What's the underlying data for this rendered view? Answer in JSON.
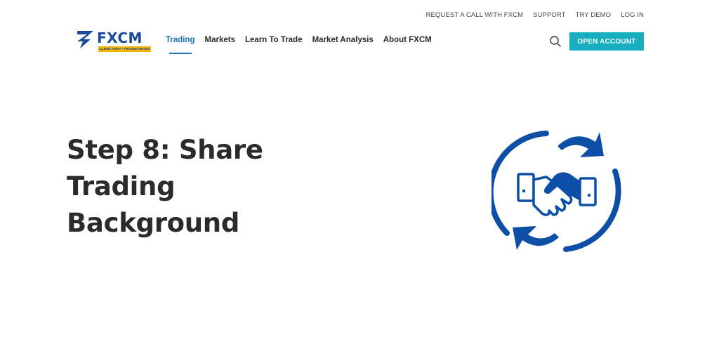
{
  "utility_nav": {
    "request_call": "REQUEST A CALL WITH FXCM",
    "support": "SUPPORT",
    "try_demo": "TRY DEMO",
    "log_in": "LOG IN"
  },
  "logo": {
    "text": "FXCM",
    "tagline": "CLIENT FIRST • TRADER DRIVEN",
    "brand_color": "#1a4a9c",
    "tagline_bg": "#f4b400"
  },
  "main_nav": {
    "items": [
      {
        "label": "Trading",
        "active": true
      },
      {
        "label": "Markets",
        "active": false
      },
      {
        "label": "Learn To Trade",
        "active": false
      },
      {
        "label": "Market Analysis",
        "active": false
      },
      {
        "label": "About FXCM",
        "active": false
      }
    ],
    "active_color": "#1a73b5"
  },
  "header_actions": {
    "search_icon": "search-icon",
    "open_account_label": "OPEN ACCOUNT",
    "open_account_color": "#18aec2"
  },
  "hero": {
    "title": "Step 8: Share Trading Background",
    "graphic_icon": "handshake-exchange-icon",
    "graphic_color": "#0d4fa6"
  }
}
